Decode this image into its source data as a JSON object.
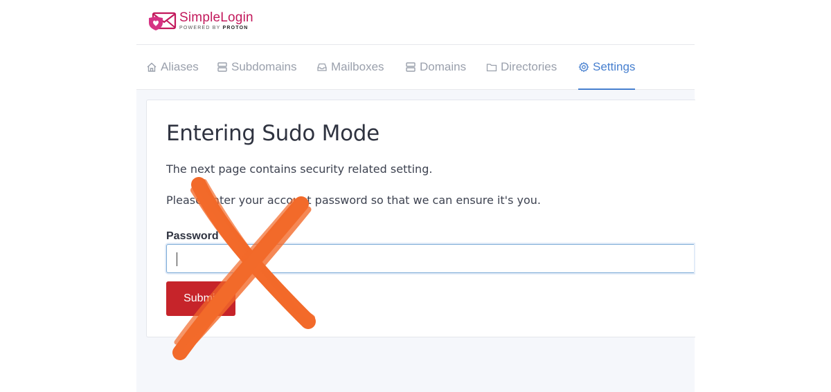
{
  "brand": {
    "name": "SimpleLogin",
    "tagline_prefix": "POWERED BY",
    "tagline_brand": "PROTON",
    "color": "#c2185b"
  },
  "nav": {
    "items": [
      {
        "label": "Aliases",
        "icon": "home-icon"
      },
      {
        "label": "Subdomains",
        "icon": "server-icon"
      },
      {
        "label": "Mailboxes",
        "icon": "inbox-icon"
      },
      {
        "label": "Domains",
        "icon": "server-icon"
      },
      {
        "label": "Directories",
        "icon": "folder-icon"
      },
      {
        "label": "Settings",
        "icon": "gear-icon",
        "active": true
      }
    ],
    "active_color": "#467fcf"
  },
  "sudo": {
    "title": "Entering Sudo Mode",
    "paragraph1": "The next page contains security related setting.",
    "paragraph2": "Please enter your account password so that we can ensure it's you.",
    "password_label": "Password",
    "password_value": "",
    "submit_label": "Submit",
    "submit_color": "#c6242a"
  },
  "overlay": {
    "mark": "cross-mark",
    "color": "#f26a2a"
  }
}
